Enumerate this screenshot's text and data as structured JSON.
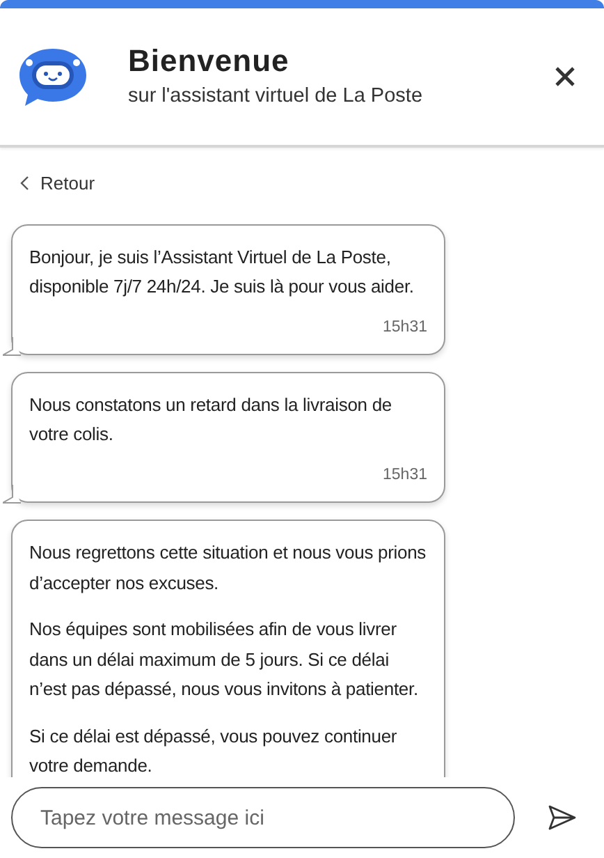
{
  "header": {
    "title": "Bienvenue",
    "subtitle": "sur l'assistant virtuel de La Poste"
  },
  "back_link": {
    "label": "Retour"
  },
  "messages": [
    {
      "paragraphs": [
        "Bonjour, je suis l’Assistant Virtuel de La Poste, disponible 7j/7 24h/24. Je suis là pour vous aider."
      ],
      "time": "15h31"
    },
    {
      "paragraphs": [
        "Nous constatons un retard dans la livraison de votre colis."
      ],
      "time": "15h31"
    },
    {
      "paragraphs": [
        "Nous regrettons cette situation et nous vous prions d’accepter nos excuses.",
        "Nos équipes sont mobilisées afin de vous livrer dans un délai maximum de 5 jours. Si ce délai n’est pas dépassé, nous vous invitons à patienter.",
        "Si ce délai est dépassé, vous pouvez continuer votre demande."
      ]
    }
  ],
  "composer": {
    "placeholder": "Tapez votre message ici"
  }
}
